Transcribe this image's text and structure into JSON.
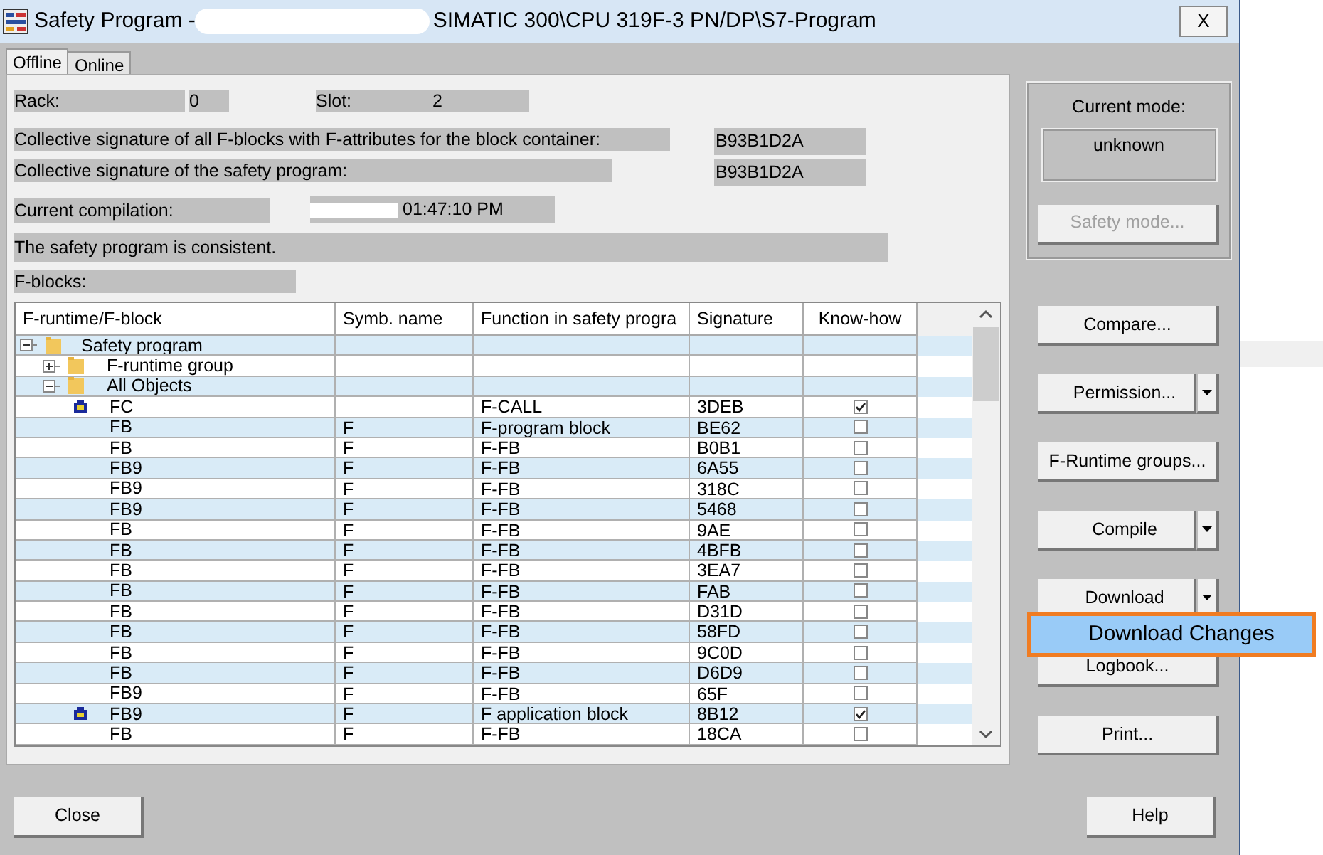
{
  "window": {
    "title_start": "Safety Program - ",
    "title_end": "SIMATIC 300\\CPU 319F-3 PN/DP\\S7-Program",
    "close": "X"
  },
  "tabs": [
    {
      "label": "Offline",
      "selected": true
    },
    {
      "label": "Online",
      "selected": false
    }
  ],
  "rack": {
    "label": "Rack:",
    "value": "0"
  },
  "slot": {
    "label": "Slot:",
    "value": "2"
  },
  "signatures": [
    {
      "label": "Collective signature of all F-blocks with F-attributes for the block container:",
      "value": "B93B1D2A"
    },
    {
      "label": "Collective signature of the safety program:",
      "value": "B93B1D2A"
    }
  ],
  "compilation": {
    "label": "Current compilation:",
    "value": "01:47:10 PM"
  },
  "status": "The safety program is consistent.",
  "fblocks_label": "F-blocks:",
  "table": {
    "columns": [
      "F-runtime/F-block",
      "Symb. name",
      "Function in safety progra",
      "Signature",
      "Know-how"
    ],
    "tree": [
      {
        "label": "Safety program",
        "expanded": true,
        "children": [
          {
            "label": "F-runtime group",
            "expanded": false
          },
          {
            "label": "All Objects",
            "expanded": true,
            "children": [
              {
                "block": "FC",
                "function": "F-CALL",
                "signature": "3DEB",
                "know_how": true,
                "protected": true
              },
              {
                "block": "FB",
                "symbol": "F",
                "function": "F-program block",
                "signature": "BE62",
                "know_how": false,
                "protected": false
              },
              {
                "block": "FB",
                "symbol": "F",
                "function": "F-FB",
                "signature": "B0B1",
                "know_how": false,
                "protected": false
              },
              {
                "block": "FB9",
                "symbol": "F",
                "function": "F-FB",
                "signature": "6A55",
                "know_how": false,
                "protected": false
              },
              {
                "block": "FB9",
                "symbol": "F",
                "function": "F-FB",
                "signature": "318C",
                "know_how": false,
                "protected": false
              },
              {
                "block": "FB9",
                "symbol": "F",
                "function": "F-FB",
                "signature": "5468",
                "know_how": false,
                "protected": false
              },
              {
                "block": "FB",
                "symbol": "F",
                "function": "F-FB",
                "signature": "9AE",
                "know_how": false,
                "protected": false
              },
              {
                "block": "FB",
                "symbol": "F",
                "function": "F-FB",
                "signature": "4BFB",
                "know_how": false,
                "protected": false
              },
              {
                "block": "FB",
                "symbol": "F",
                "function": "F-FB",
                "signature": "3EA7",
                "know_how": false,
                "protected": false
              },
              {
                "block": "FB",
                "symbol": "F",
                "function": "F-FB",
                "signature": "FAB",
                "know_how": false,
                "protected": false
              },
              {
                "block": "FB",
                "symbol": "F",
                "function": "F-FB",
                "signature": "D31D",
                "know_how": false,
                "protected": false
              },
              {
                "block": "FB",
                "symbol": "F",
                "function": "F-FB",
                "signature": "58FD",
                "know_how": false,
                "protected": false
              },
              {
                "block": "FB",
                "symbol": "F",
                "function": "F-FB",
                "signature": "9C0D",
                "know_how": false,
                "protected": false
              },
              {
                "block": "FB",
                "symbol": "F",
                "function": "F-FB",
                "signature": "D6D9",
                "know_how": false,
                "protected": false
              },
              {
                "block": "FB9",
                "symbol": "F",
                "function": "F-FB",
                "signature": "65F",
                "know_how": false,
                "protected": false
              },
              {
                "block": "FB9",
                "symbol": "F",
                "function": "F application block",
                "signature": "8B12",
                "know_how": true,
                "protected": true
              },
              {
                "block": "FB",
                "symbol": "F",
                "function": "F-FB",
                "signature": "18CA",
                "know_how": false,
                "protected": false
              }
            ]
          }
        ]
      }
    ]
  },
  "mode": {
    "label": "Current mode:",
    "value": "unknown",
    "button": {
      "label": "Safety mode...",
      "disabled": true
    }
  },
  "actions": [
    {
      "label": "Compare...",
      "dropdown": false
    },
    {
      "label": "Permission...",
      "dropdown": true
    },
    {
      "label": "F-Runtime groups...",
      "dropdown": false
    },
    {
      "label": "Compile",
      "dropdown": true
    },
    {
      "label": "Download",
      "dropdown": true
    },
    {
      "label": "Logbook...",
      "dropdown": false
    },
    {
      "label": "Print...",
      "dropdown": false
    }
  ],
  "menu": {
    "items": [
      {
        "label": "Download Changes",
        "selected": true
      }
    ]
  },
  "footer": {
    "close": "Close",
    "help": "Help"
  }
}
